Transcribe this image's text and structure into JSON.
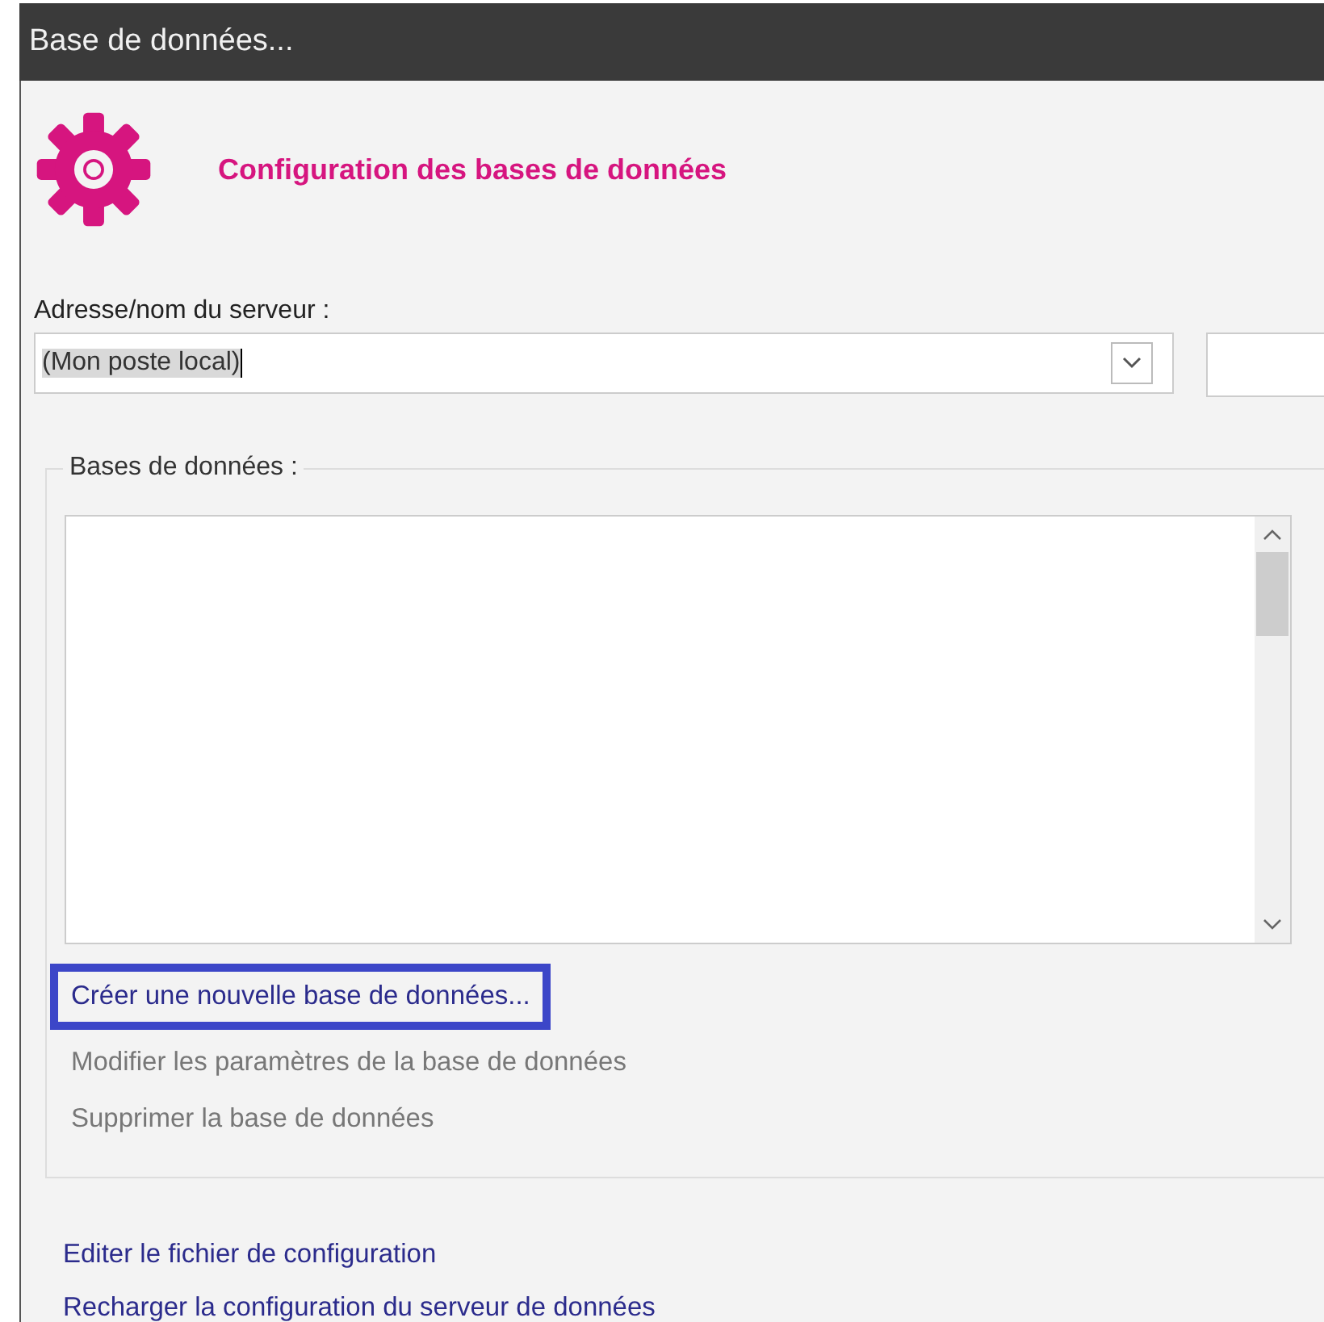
{
  "window": {
    "title": "Base de données..."
  },
  "header": {
    "title": "Configuration des bases de données"
  },
  "server": {
    "label": "Adresse/nom du serveur :",
    "value": "(Mon poste local)"
  },
  "databases": {
    "legend": "Bases de données :",
    "actions": [
      {
        "label": "Créer une nouvelle base de données...",
        "disabled": false,
        "highlighted": true
      },
      {
        "label": "Modifier les paramètres de la base de données",
        "disabled": true,
        "highlighted": false
      },
      {
        "label": "Supprimer la base de données",
        "disabled": true,
        "highlighted": false
      }
    ]
  },
  "links": [
    {
      "label": "Editer le fichier de configuration"
    },
    {
      "label": "Recharger la configuration du serveur de données"
    }
  ]
}
